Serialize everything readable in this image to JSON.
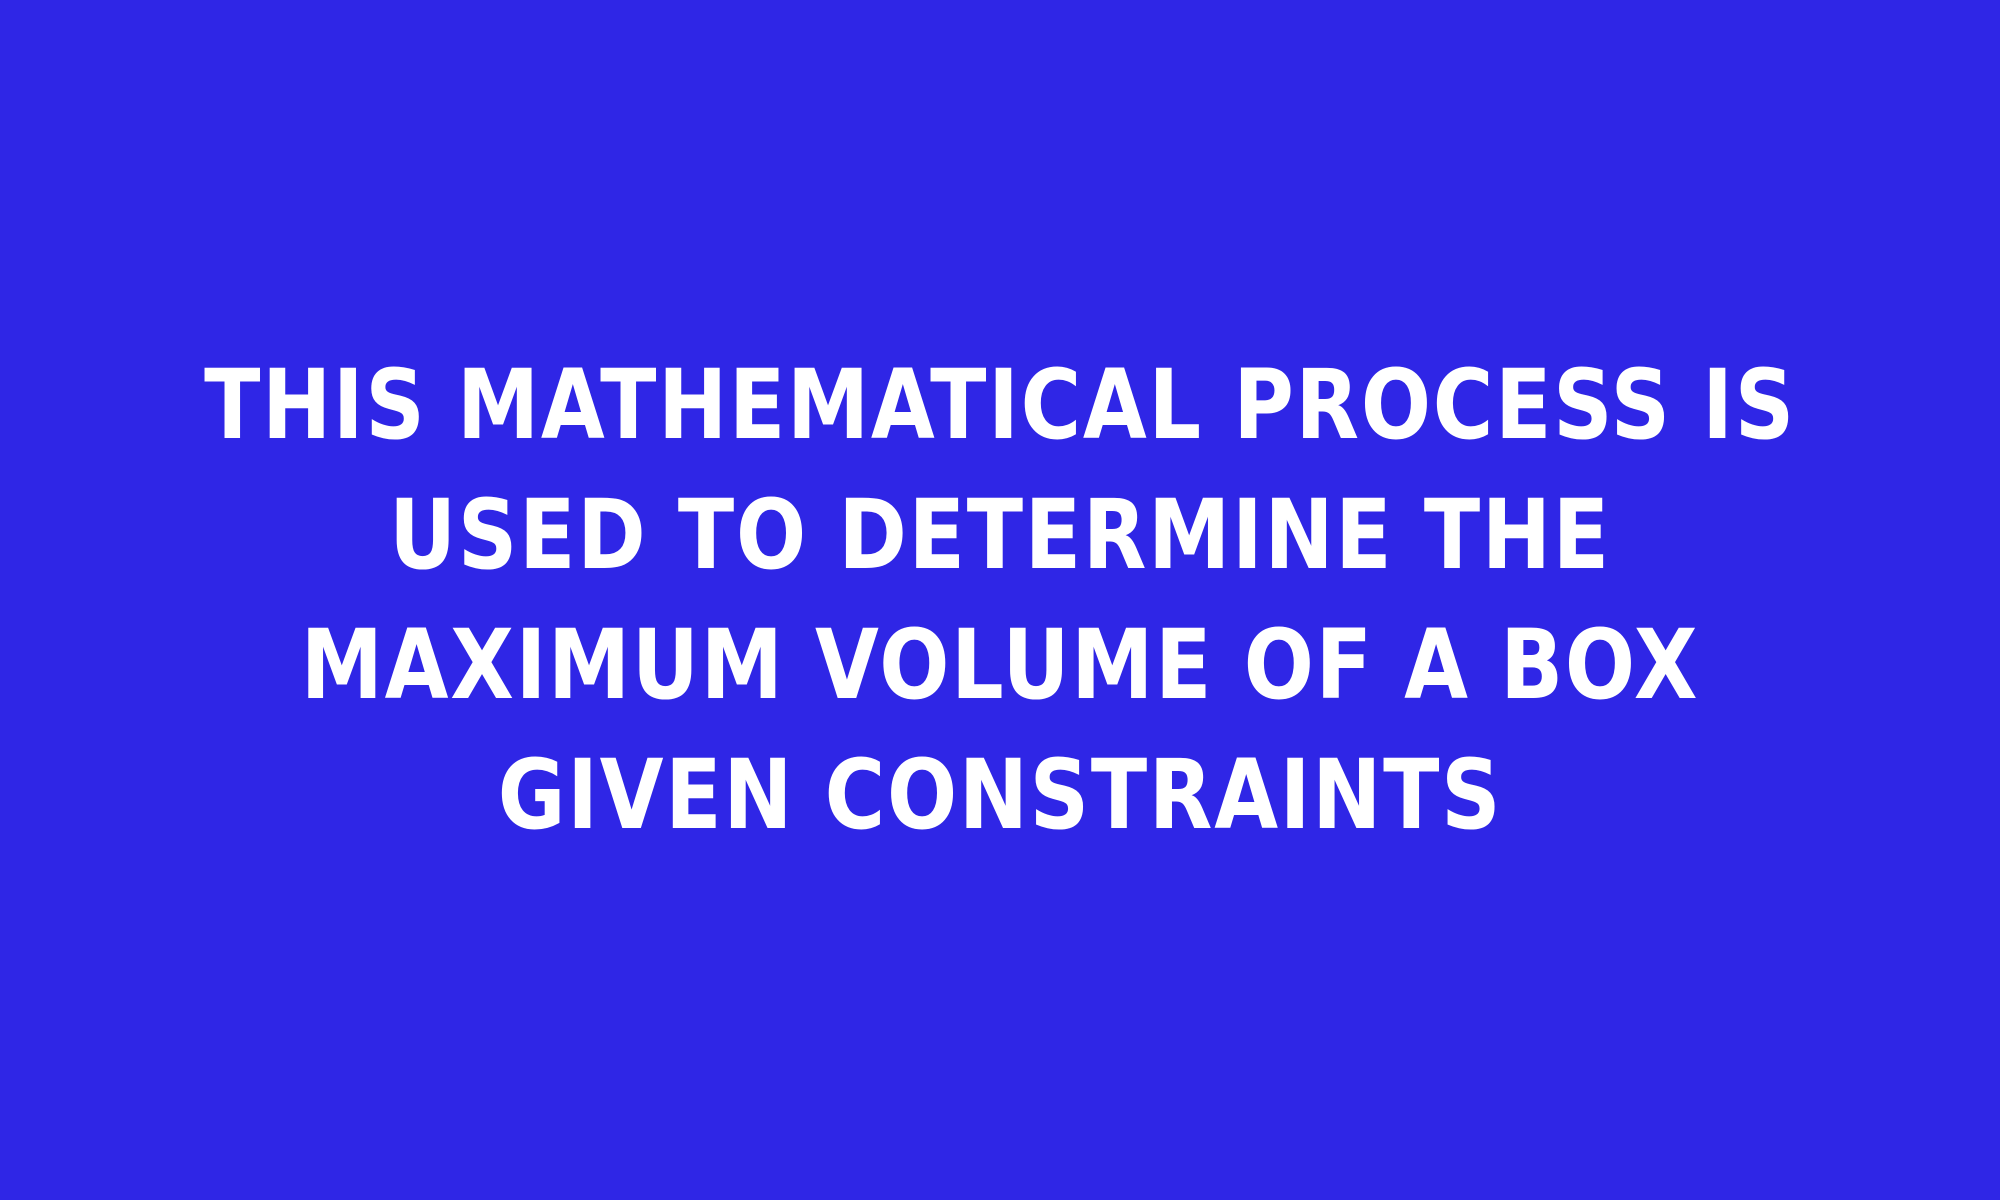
{
  "clue": {
    "text": "THIS MATHEMATICAL PROCESS IS USED TO DETERMINE THE MAXIMUM VOLUME OF A BOX GIVEN CONSTRAINTS"
  },
  "colors": {
    "background": "#2f26e6",
    "text": "#ffffff"
  }
}
